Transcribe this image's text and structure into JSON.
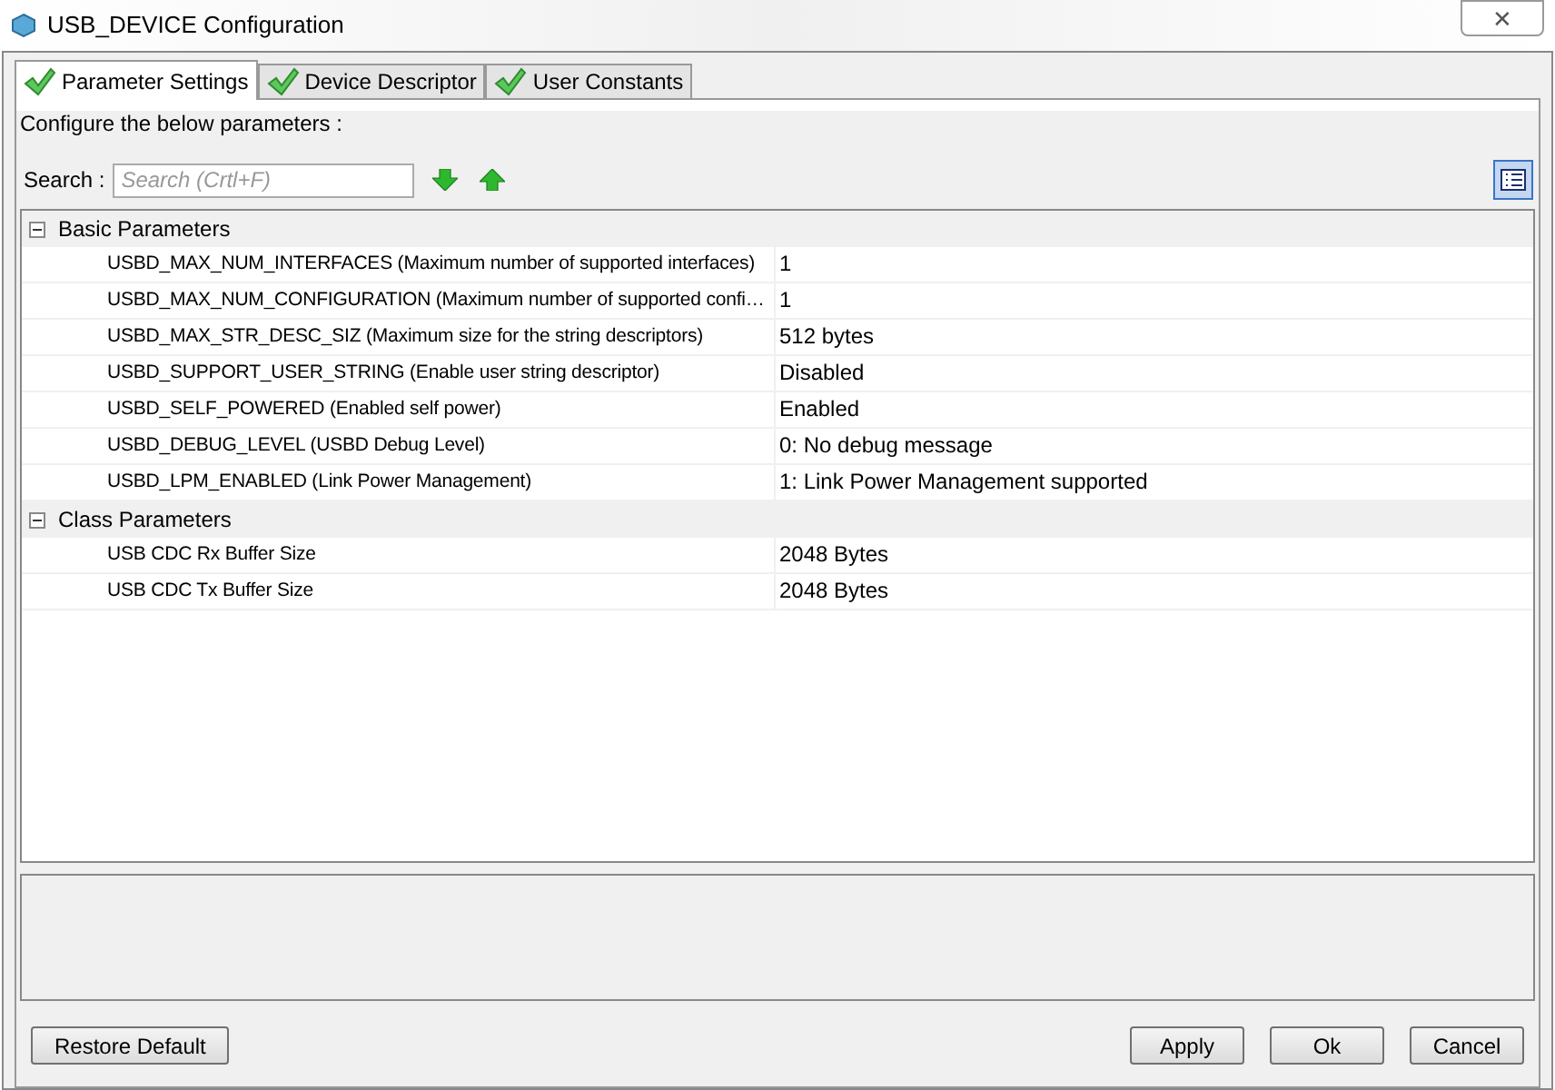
{
  "window": {
    "title": "USB_DEVICE Configuration",
    "close": "✕"
  },
  "tabs": [
    {
      "label": "Parameter Settings",
      "selected": true
    },
    {
      "label": "Device Descriptor",
      "selected": false
    },
    {
      "label": "User Constants",
      "selected": false
    }
  ],
  "intro": "Configure the below parameters :",
  "search": {
    "label": "Search :",
    "placeholder": "Search (Crtl+F)"
  },
  "groups": [
    {
      "name": "Basic Parameters",
      "expanded": true,
      "rows": [
        {
          "name": "USBD_MAX_NUM_INTERFACES (Maximum number of supported interfaces)",
          "value": "1"
        },
        {
          "name": "USBD_MAX_NUM_CONFIGURATION (Maximum number of supported confi…",
          "value": "1"
        },
        {
          "name": "USBD_MAX_STR_DESC_SIZ (Maximum size for the string descriptors)",
          "value": "512 bytes"
        },
        {
          "name": "USBD_SUPPORT_USER_STRING (Enable user string descriptor)",
          "value": "Disabled"
        },
        {
          "name": "USBD_SELF_POWERED (Enabled self power)",
          "value": "Enabled"
        },
        {
          "name": "USBD_DEBUG_LEVEL (USBD Debug Level)",
          "value": "0: No debug message"
        },
        {
          "name": "USBD_LPM_ENABLED (Link Power Management)",
          "value": "1: Link Power Management supported"
        }
      ]
    },
    {
      "name": "Class Parameters",
      "expanded": true,
      "rows": [
        {
          "name": "USB CDC Rx Buffer Size",
          "value": "2048 Bytes"
        },
        {
          "name": "USB CDC Tx Buffer Size",
          "value": "2048 Bytes"
        }
      ]
    }
  ],
  "buttons": {
    "restore": "Restore Default",
    "actions": [
      "Apply",
      "Ok",
      "Cancel"
    ]
  }
}
